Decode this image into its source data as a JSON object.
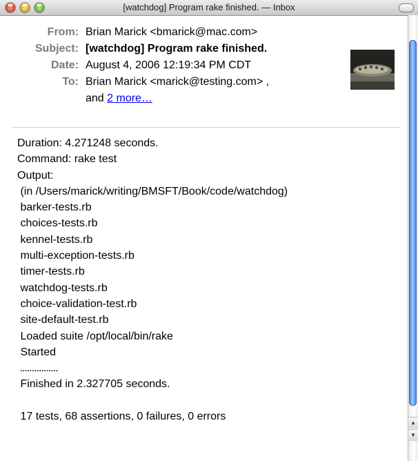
{
  "window": {
    "title": "[watchdog] Program rake finished. — Inbox"
  },
  "header": {
    "from_label": "From:",
    "from_value": "Brian Marick <bmarick@mac.com>",
    "subject_label": "Subject:",
    "subject_value": "[watchdog] Program rake finished.",
    "date_label": "Date:",
    "date_value": "August 4, 2006 12:19:34 PM CDT",
    "to_label": "To:",
    "to_value": "Brian Marick <marick@testing.com> ,",
    "more_prefix": "and ",
    "more_link": "2 more…"
  },
  "body": {
    "lines": [
      "Duration: 4.271248 seconds.",
      "Command: rake test",
      "Output:",
      " (in /Users/marick/writing/BMSFT/Book/code/watchdog)",
      " barker-tests.rb",
      " choices-tests.rb",
      " kennel-tests.rb",
      " multi-exception-tests.rb",
      " timer-tests.rb",
      " watchdog-tests.rb",
      " choice-validation-test.rb",
      " site-default-test.rb",
      " Loaded suite /opt/local/bin/rake",
      " Started",
      " ................",
      " Finished in 2.327705 seconds.",
      "",
      " 17 tests, 68 assertions, 0 failures, 0 errors"
    ]
  },
  "icons": {
    "close": "close-window-icon",
    "minimize": "minimize-window-icon",
    "zoom": "zoom-window-icon",
    "toolbar": "toolbar-toggle-icon",
    "scroll_up": "scroll-up-arrow-icon",
    "scroll_down": "scroll-down-arrow-icon"
  },
  "colors": {
    "label_gray": "#7b7b7b",
    "link_blue": "#0000ee",
    "scroll_blue": "#3a80df"
  }
}
